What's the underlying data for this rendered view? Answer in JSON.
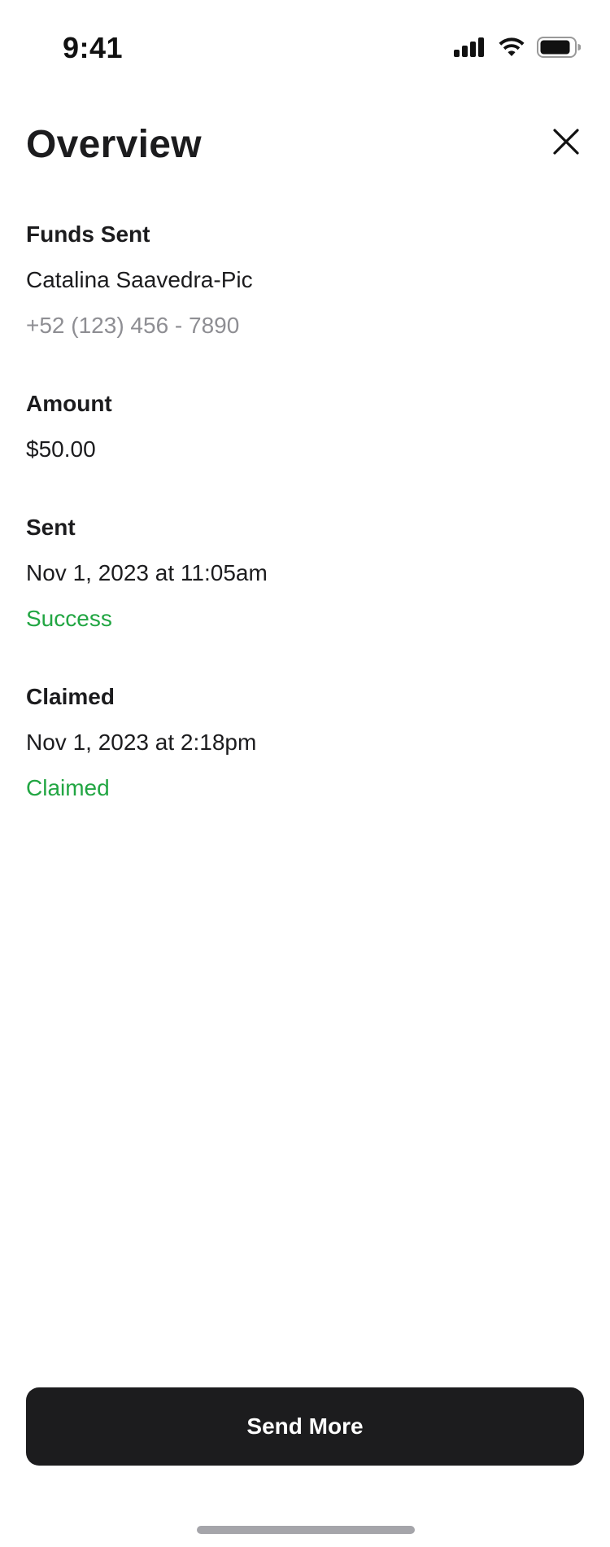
{
  "status_bar": {
    "time": "9:41",
    "icons": [
      "signal-icon",
      "wifi-icon",
      "battery-icon"
    ]
  },
  "header": {
    "title": "Overview",
    "close_icon": "close-icon"
  },
  "funds_sent": {
    "label": "Funds Sent",
    "recipient_name": "Catalina Saavedra-Pic",
    "recipient_phone": "+52 (123) 456 - 7890"
  },
  "amount": {
    "label": "Amount",
    "value": "$50.00"
  },
  "sent": {
    "label": "Sent",
    "datetime": "Nov 1, 2023 at 11:05am",
    "status": "Success"
  },
  "claimed": {
    "label": "Claimed",
    "datetime": "Nov 1, 2023 at 2:18pm",
    "status": "Claimed"
  },
  "actions": {
    "send_more_label": "Send More"
  },
  "colors": {
    "success": "#22a643",
    "primary_button": "#1c1c1e",
    "secondary_text": "#8e8e93"
  }
}
